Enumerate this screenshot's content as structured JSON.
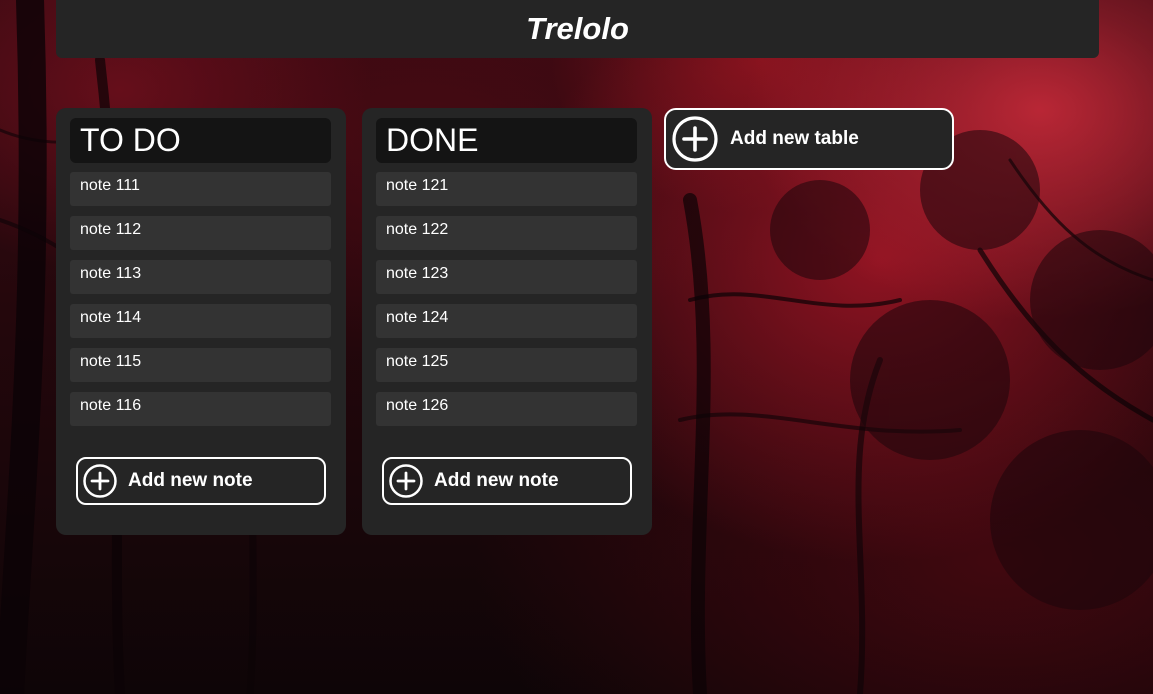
{
  "app": {
    "title": "Trelolo"
  },
  "tables": [
    {
      "title": "TO DO",
      "notes": [
        "note 111",
        "note 112",
        "note 113",
        "note 114",
        "note 115",
        "note 116"
      ],
      "add_note_label": "Add new note"
    },
    {
      "title": "DONE",
      "notes": [
        "note 121",
        "note 122",
        "note 123",
        "note 124",
        "note 125",
        "note 126"
      ],
      "add_note_label": "Add new note"
    }
  ],
  "add_table": {
    "label": "Add new table",
    "icon": "plus-circle-icon"
  },
  "colors": {
    "panel": "#252525",
    "title_bar": "#141414",
    "note": "#333333",
    "text": "#ffffff"
  }
}
